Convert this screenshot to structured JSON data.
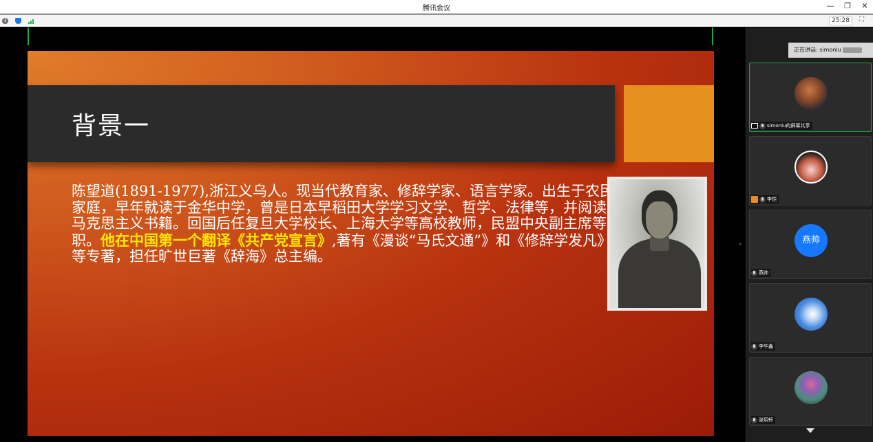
{
  "window": {
    "title": "腾讯会议",
    "minimize_icon": "—",
    "maximize_icon": "❐",
    "close_icon": "✕"
  },
  "status_bar": {
    "info_icon": "i",
    "timer": "25:28",
    "fullscreen_icon": "⛶"
  },
  "slide": {
    "title": "背景一",
    "body_plain_1": "陈望道(1891-1977),浙江义乌人。现当代教育家、修辞学家、语言学家。出生于农民家庭，早年就读于金华中学，曾是日本早稻田大学学习文学、哲学、法律等，并阅读马克思主义书籍。回国后任复旦大学校长、上海大学等高校教师，民盟中央副主席等职。",
    "body_highlight": "他在中国第一个翻译《共产党宣言》",
    "body_plain_2": ",著有《漫谈“马氏文通”》和《修辞学发凡》等专著，担任旷世巨著《辞海》总主编。"
  },
  "panel": {
    "speaking_label": "正在讲话: simonlu",
    "participants": [
      {
        "name": "simonlu的屏幕共享",
        "type": "screen-share"
      },
      {
        "name": "李恺",
        "type": "user"
      },
      {
        "name": "燕帅",
        "avatar_text": "燕帅",
        "type": "user"
      },
      {
        "name": "李华鑫",
        "type": "user"
      },
      {
        "name": "张玥轩",
        "type": "user"
      }
    ]
  },
  "colors": {
    "active_border": "#1aab3c",
    "highlight_text": "#ffe600",
    "accent_block": "#e6911e",
    "avatar_blue": "#1677ff"
  }
}
